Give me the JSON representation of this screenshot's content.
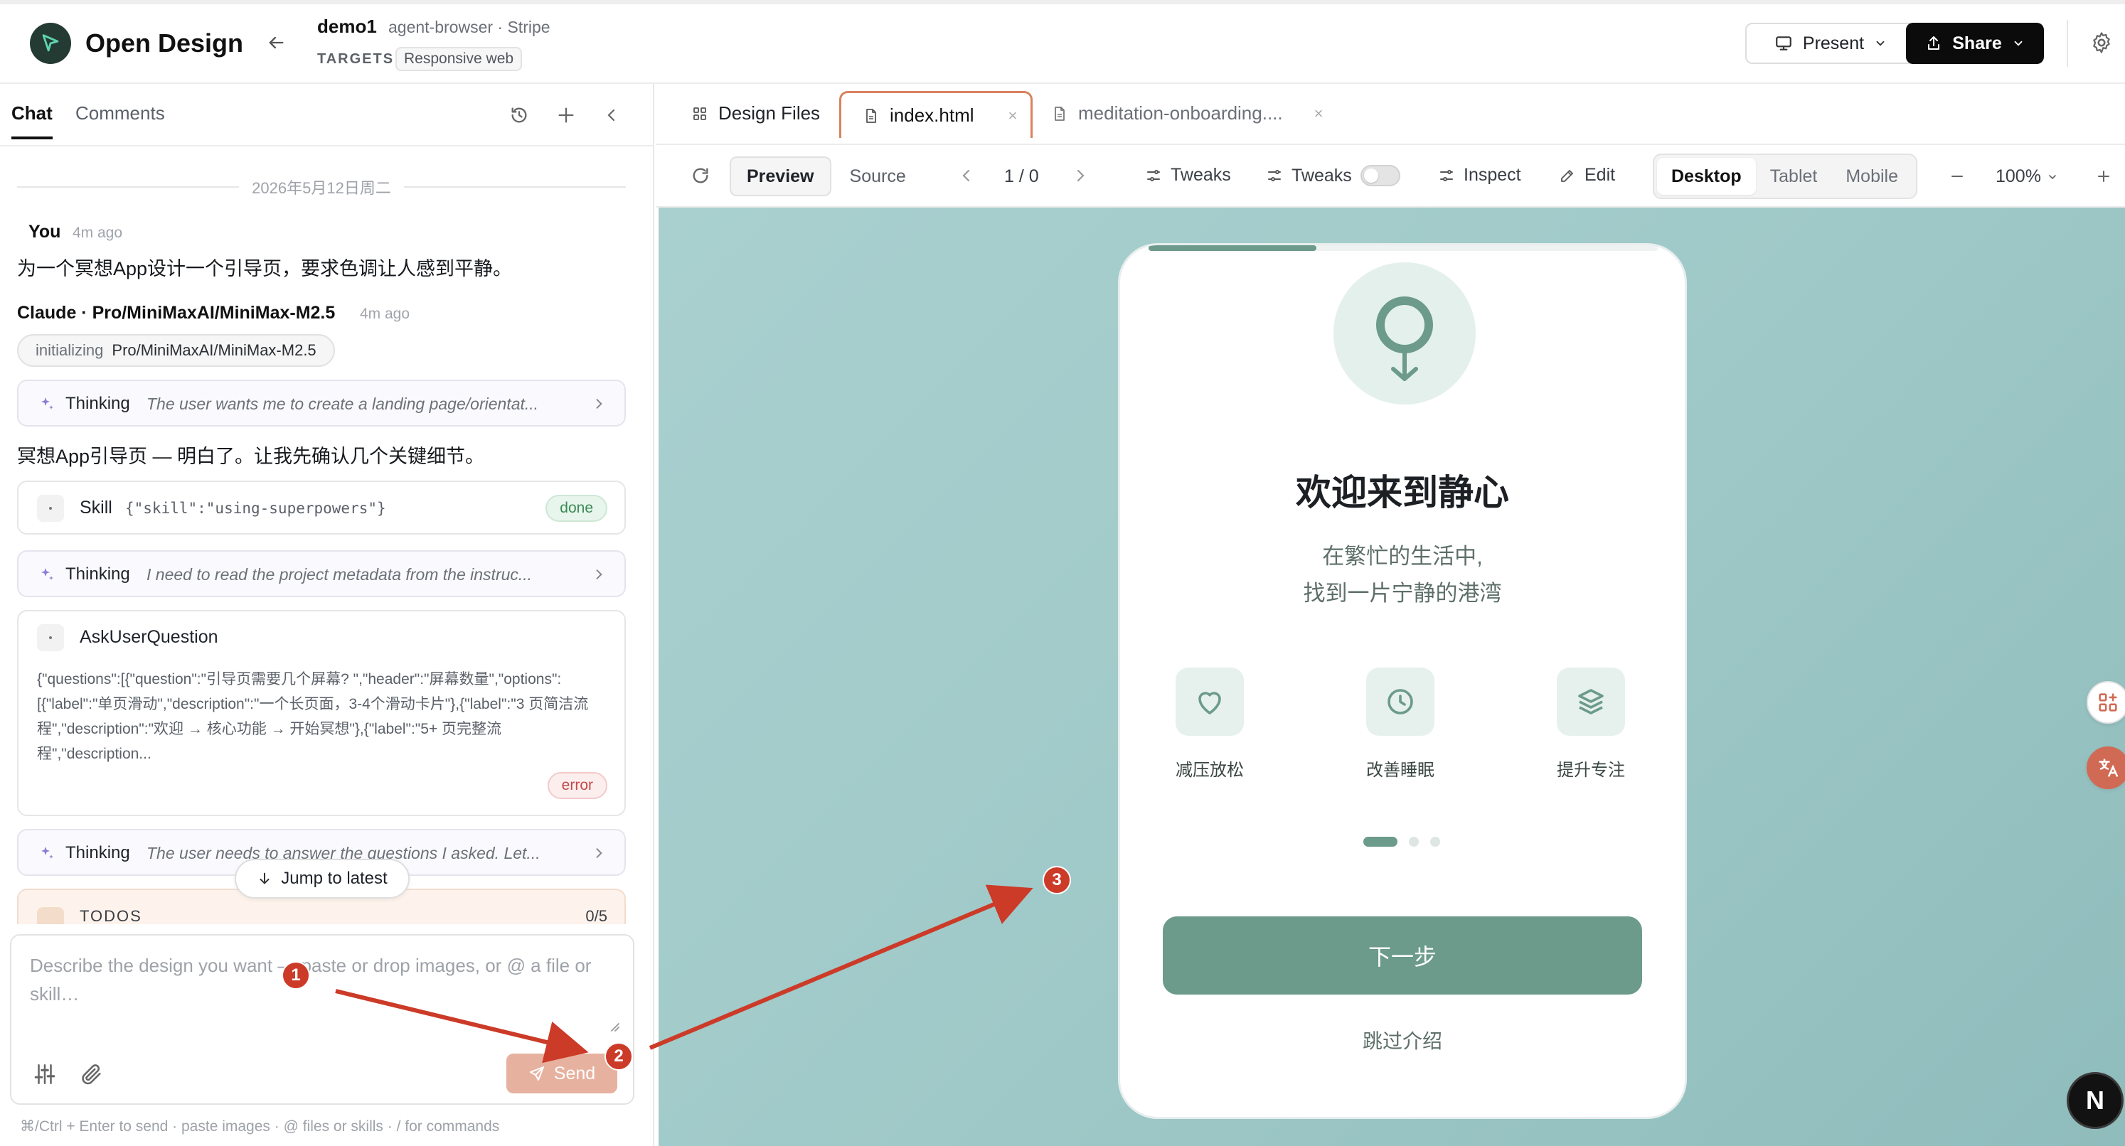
{
  "app": {
    "name": "Open Design"
  },
  "project": {
    "name": "demo1",
    "meta": "agent-browser · Stripe",
    "targets_label": "TARGETS",
    "target": "Responsive web"
  },
  "header": {
    "present_label": "Present",
    "share_label": "Share"
  },
  "left_panel": {
    "tabs": [
      {
        "label": "Chat"
      },
      {
        "label": "Comments"
      }
    ],
    "date_divider": "2026年5月12日周二",
    "user_msg": {
      "author": "You",
      "time": "4m ago",
      "text": "为一个冥想App设计一个引导页，要求色调让人感到平静。"
    },
    "assistant": {
      "author": "Claude · Pro/MiniMaxAI/MiniMax-M2.5",
      "time": "4m ago",
      "init_key": "initializing",
      "init_value": "Pro/MiniMaxAI/MiniMax-M2.5",
      "reply": "冥想App引导页 — 明白了。让我先确认几个关键细节。"
    },
    "thinking_label": "Thinking",
    "thinking": [
      {
        "text": "The user wants me to create a landing page/orientat..."
      },
      {
        "text": "I need to read the project metadata from the instruc..."
      },
      {
        "text": "The user needs to answer the questions I asked. Let..."
      }
    ],
    "skill": {
      "name": "Skill",
      "args": "{\"skill\":\"using-superpowers\"}",
      "status": "done"
    },
    "ask": {
      "name": "AskUserQuestion",
      "args": "{\"questions\":[{\"question\":\"引导页需要几个屏幕? \",\"header\":\"屏幕数量\",\"options\":[{\"label\":\"单页滑动\",\"description\":\"一个长页面，3-4个滑动卡片\"},{\"label\":\"3 页简洁流程\",\"description\":\"欢迎 → 核心功能 → 开始冥想\"},{\"label\":\"5+ 页完整流程\",\"description...",
      "status": "error"
    },
    "todos": {
      "label": "TODOS",
      "count": "0/5"
    },
    "jump_label": "Jump to latest",
    "composer": {
      "placeholder": "Describe the design you want — paste or drop images, or @ a file or skill…",
      "send_label": "Send"
    },
    "hint": "⌘/Ctrl + Enter to send · paste images · @ files or skills · / for commands"
  },
  "file_tabs": [
    {
      "label": "Design Files"
    },
    {
      "label": "index.html",
      "close": "×"
    },
    {
      "label": "meditation-onboarding....",
      "close": "×"
    }
  ],
  "toolbar": {
    "preview_label": "Preview",
    "source_label": "Source",
    "page_indicator": "1 / 0",
    "tweaks_label": "Tweaks",
    "tweaks_toggle_label": "Tweaks",
    "inspect_label": "Inspect",
    "edit_label": "Edit",
    "devices": [
      {
        "label": "Desktop"
      },
      {
        "label": "Tablet"
      },
      {
        "label": "Mobile"
      }
    ],
    "zoom": "100%"
  },
  "preview": {
    "progress": 0.33,
    "title": "欢迎来到静心",
    "subtitle_line1": "在繁忙的生活中,",
    "subtitle_line2": "找到一片宁静的港湾",
    "features": [
      {
        "label": "减压放松"
      },
      {
        "label": "改善睡眠"
      },
      {
        "label": "提升专注"
      }
    ],
    "next_label": "下一步",
    "skip_label": "跳过介绍",
    "accent_color": "#6c9a8b"
  },
  "user_badge": "N",
  "annotations": [
    {
      "label": "1"
    },
    {
      "label": "2"
    },
    {
      "label": "3"
    }
  ],
  "colors": {
    "annotation": "#cc3a28",
    "send_button": "#e7b19f",
    "active_tab_border": "#d9825f"
  }
}
